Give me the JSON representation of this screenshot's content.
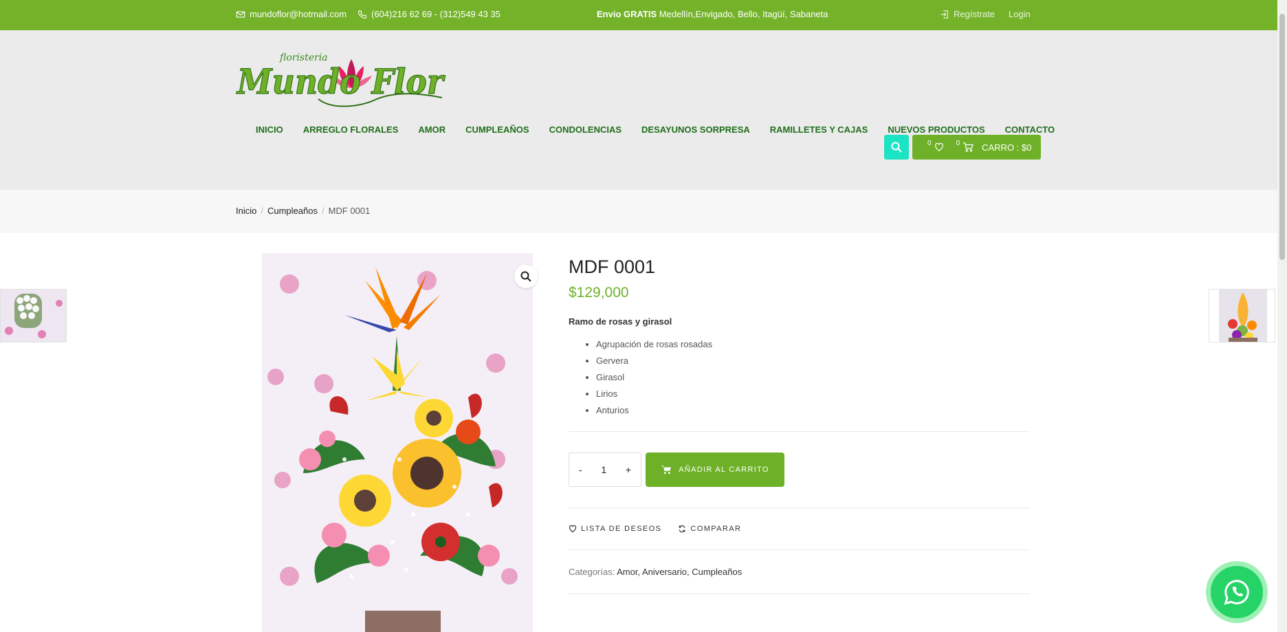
{
  "topbar": {
    "email": "mundoflor@hotmail.com",
    "phone": "(604)216 62 69 - (312)549 43 35",
    "shipping_bold": "Envio GRATIS",
    "shipping_rest": " Medellín,Envigado, Bello, Itagüí, Sabaneta",
    "register": "Regístrate",
    "login": "Login"
  },
  "logo": {
    "brand": "Mundo Flor",
    "tagline": "floristeria"
  },
  "nav": [
    "INICIO",
    "ARREGLO FLORALES",
    "AMOR",
    "CUMPLEAÑOS",
    "CONDOLENCIAS",
    "DESAYUNOS SORPRESA",
    "RAMILLETES Y CAJAS",
    "NUEVOS PRODUCTOS",
    "CONTACTO"
  ],
  "cart": {
    "wishlist_count": "0",
    "cart_count": "0",
    "label": "CARRO : $0"
  },
  "breadcrumb": {
    "home": "Inicio",
    "category": "Cumpleaños",
    "current": "MDF 0001"
  },
  "product": {
    "title": "MDF 0001",
    "price": "$129,000",
    "short_description": "Ramo de rosas y girasol",
    "features": [
      "Agrupación de rosas rosadas",
      "Gervera",
      "Girasol",
      "Lirios",
      "Anturios"
    ],
    "quantity": "1",
    "minus": "-",
    "plus": "+",
    "add_to_cart": "AÑADIR AL CARRITO",
    "wishlist": "LISTA DE DESEOS",
    "compare": "COMPARAR",
    "categories_label": "Categorías:",
    "categories": "Amor, Aniversario, Cumpleaños"
  },
  "colors": {
    "brand_green": "#74b22a",
    "button_green": "#6eb129",
    "nav_green": "#1f6e1a",
    "search_teal": "#1ce3c4",
    "whatsapp": "#25d366"
  }
}
